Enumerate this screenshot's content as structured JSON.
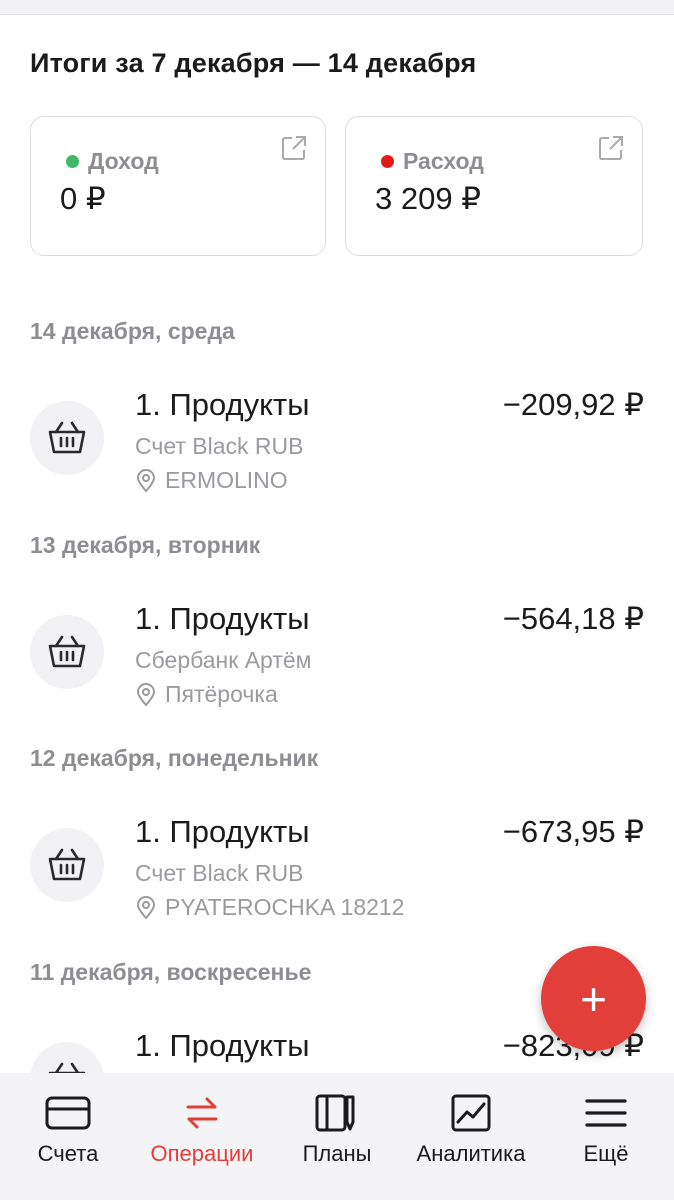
{
  "summary": {
    "title": "Итоги за 7 декабря — 14 декабря",
    "income": {
      "label": "Доход",
      "amount": "0 ₽",
      "dot_color": "#3fb867"
    },
    "expense": {
      "label": "Расход",
      "amount": "3 209 ₽",
      "dot_color": "#e31b1b"
    }
  },
  "groups": [
    {
      "date": "14 декабря, среда",
      "transaction": {
        "category": "1. Продукты",
        "account": "Счет Black RUB",
        "place": "ERMOLINO",
        "amount": "−209,92 ₽",
        "icon": "basket-icon"
      }
    },
    {
      "date": "13 декабря, вторник",
      "transaction": {
        "category": "1. Продукты",
        "account": "Сбербанк Артём",
        "place": "Пятёрочка",
        "amount": "−564,18 ₽",
        "icon": "basket-icon"
      }
    },
    {
      "date": "12 декабря, понедельник",
      "transaction": {
        "category": "1. Продукты",
        "account": "Счет Black RUB",
        "place": "PYATEROCHKA 18212",
        "amount": "−673,95 ₽",
        "icon": "basket-icon"
      }
    },
    {
      "date": "11 декабря, воскресенье",
      "transaction": {
        "category": "1. Продукты",
        "amount": "−823,09 ₽",
        "icon": "basket-icon"
      }
    }
  ],
  "fab": {
    "label": "+",
    "color": "#e23f3a"
  },
  "nav": {
    "items": [
      {
        "label": "Счета",
        "icon": "card-icon"
      },
      {
        "label": "Операции",
        "icon": "transfer-icon",
        "active": true
      },
      {
        "label": "Планы",
        "icon": "plans-icon"
      },
      {
        "label": "Аналитика",
        "icon": "chart-icon"
      },
      {
        "label": "Ещё",
        "icon": "menu-icon"
      }
    ],
    "active_color": "#e23f3a"
  }
}
